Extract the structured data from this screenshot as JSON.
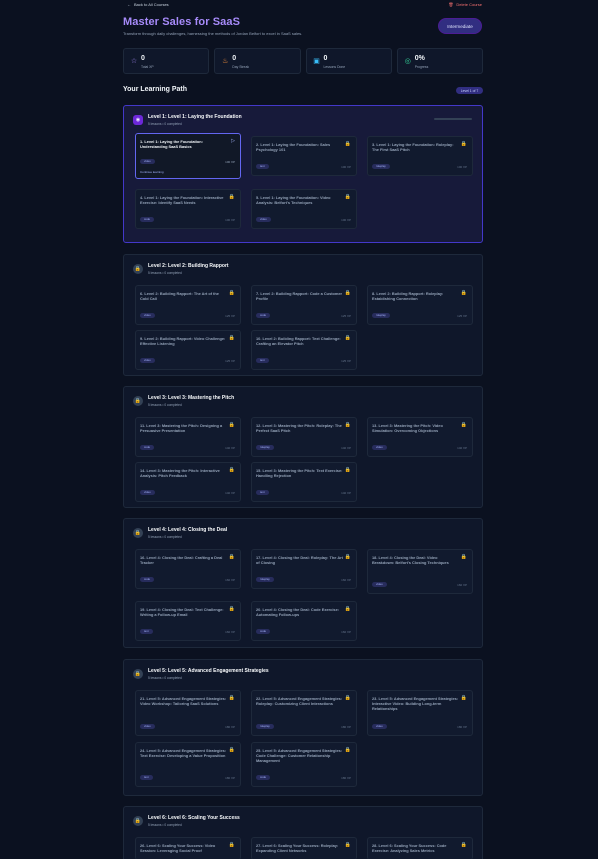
{
  "header": {
    "back_label": "Back to All Courses",
    "delete_label": "Delete Course",
    "title": "Master Sales for SaaS",
    "subtitle": "Transform through daily challenges, harnessing the methods of Jordan Belfort to excel in SaaS sales.",
    "difficulty": "Intermediate"
  },
  "stats": [
    {
      "icon": "star-icon",
      "value": "0",
      "label": "Total XP",
      "color": "#a78bfa"
    },
    {
      "icon": "fire-icon",
      "value": "0",
      "label": "Day Streak",
      "color": "#fb923c"
    },
    {
      "icon": "book-icon",
      "value": "0",
      "label": "Lessons Done",
      "color": "#38bdf8"
    },
    {
      "icon": "target-icon",
      "value": "0%",
      "label": "Progress",
      "color": "#34d399"
    }
  ],
  "path": {
    "title": "Your Learning Path",
    "badge": "Level 1 of 7"
  },
  "levels": [
    {
      "title": "Level 1: Level 1: Laying the Foundation",
      "sub": "5 lessons • 0 completed",
      "lessons": [
        {
          "title": "1. Level 1: Laying the Foundation: Understanding SaaS Basics",
          "tag": "video",
          "xp": "100 XP",
          "continue": "Continue learning"
        },
        {
          "title": "2. Level 1: Laying the Foundation: Sales Psychology 101",
          "tag": "text",
          "xp": "100 XP"
        },
        {
          "title": "3. Level 1: Laying the Foundation: Roleplay: The First SaaS Pitch",
          "tag": "roleplay",
          "xp": "100 XP"
        },
        {
          "title": "4. Level 1: Laying the Foundation: Interactive Exercise: Identify SaaS Needs",
          "tag": "code",
          "xp": "100 XP"
        },
        {
          "title": "5. Level 1: Laying the Foundation: Video Analysis: Belfort's Techniques",
          "tag": "video",
          "xp": "100 XP"
        }
      ]
    },
    {
      "title": "Level 2: Level 2: Building Rapport",
      "sub": "5 lessons • 0 completed",
      "lessons": [
        {
          "title": "6. Level 2: Building Rapport: The Art of the Cold Call",
          "tag": "video",
          "xp": "125 XP"
        },
        {
          "title": "7. Level 2: Building Rapport: Code a Customer Profile",
          "tag": "code",
          "xp": "125 XP"
        },
        {
          "title": "8. Level 2: Building Rapport: Roleplay: Establishing Connection",
          "tag": "roleplay",
          "xp": "125 XP"
        },
        {
          "title": "9. Level 2: Building Rapport: Video Challenge: Effective Listening",
          "tag": "video",
          "xp": "125 XP"
        },
        {
          "title": "10. Level 2: Building Rapport: Text Challenge: Crafting an Elevator Pitch",
          "tag": "text",
          "xp": "125 XP"
        }
      ]
    },
    {
      "title": "Level 3: Level 3: Mastering the Pitch",
      "sub": "5 lessons • 0 completed",
      "lessons": [
        {
          "title": "11. Level 3: Mastering the Pitch: Designing a Persuasive Presentation",
          "tag": "code",
          "xp": "140 XP"
        },
        {
          "title": "12. Level 3: Mastering the Pitch: Roleplay: The Perfect SaaS Pitch",
          "tag": "roleplay",
          "xp": "140 XP"
        },
        {
          "title": "13. Level 3: Mastering the Pitch: Video Simulation: Overcoming Objections",
          "tag": "video",
          "xp": "140 XP"
        },
        {
          "title": "14. Level 3: Mastering the Pitch: Interactive Analysis: Pitch Feedback",
          "tag": "video",
          "xp": "140 XP"
        },
        {
          "title": "15. Level 3: Mastering the Pitch: Text Exercise: Handling Rejection",
          "tag": "text",
          "xp": "140 XP"
        }
      ]
    },
    {
      "title": "Level 4: Level 4: Closing the Deal",
      "sub": "5 lessons • 0 completed",
      "lessons": [
        {
          "title": "16. Level 4: Closing the Deal: Crafting a Deal Tracker",
          "tag": "code",
          "xp": "160 XP"
        },
        {
          "title": "17. Level 4: Closing the Deal: Roleplay: The Art of Closing",
          "tag": "roleplay",
          "xp": "160 XP"
        },
        {
          "title": "18. Level 4: Closing the Deal: Video Breakdown: Belfort's Closing Techniques",
          "tag": "video",
          "xp": "160 XP"
        },
        {
          "title": "19. Level 4: Closing the Deal: Text Challenge: Writing a Follow-up Email",
          "tag": "text",
          "xp": "160 XP"
        },
        {
          "title": "20. Level 4: Closing the Deal: Code Exercise: Automating Follow-ups",
          "tag": "code",
          "xp": "160 XP"
        }
      ]
    },
    {
      "title": "Level 5: Level 5: Advanced Engagement Strategies",
      "sub": "5 lessons • 0 completed",
      "lessons": [
        {
          "title": "21. Level 5: Advanced Engagement Strategies: Video Workshop: Tailoring SaaS Solutions",
          "tag": "video",
          "xp": "180 XP"
        },
        {
          "title": "22. Level 5: Advanced Engagement Strategies: Roleplay: Customizing Client Interactions",
          "tag": "roleplay",
          "xp": "180 XP"
        },
        {
          "title": "23. Level 5: Advanced Engagement Strategies: Interactive Video: Building Long-term Relationships",
          "tag": "video",
          "xp": "180 XP"
        },
        {
          "title": "24. Level 5: Advanced Engagement Strategies: Text Exercise: Developing a Value Proposition",
          "tag": "text",
          "xp": "180 XP"
        },
        {
          "title": "25. Level 5: Advanced Engagement Strategies: Code Challenge: Customer Relationship Management",
          "tag": "code",
          "xp": "180 XP"
        }
      ]
    },
    {
      "title": "Level 6: Level 6: Scaling Your Success",
      "sub": "5 lessons • 0 completed",
      "lessons": [
        {
          "title": "26. Level 6: Scaling Your Success: Video Session: Leveraging Social Proof",
          "tag": "video",
          "xp": "200 XP"
        },
        {
          "title": "27. Level 6: Scaling Your Success: Roleplay: Expanding Client Networks",
          "tag": "roleplay",
          "xp": "200 XP"
        },
        {
          "title": "28. Level 6: Scaling Your Success: Code Exercise: Analyzing Sales Metrics",
          "tag": "code",
          "xp": "200 XP"
        }
      ]
    }
  ]
}
